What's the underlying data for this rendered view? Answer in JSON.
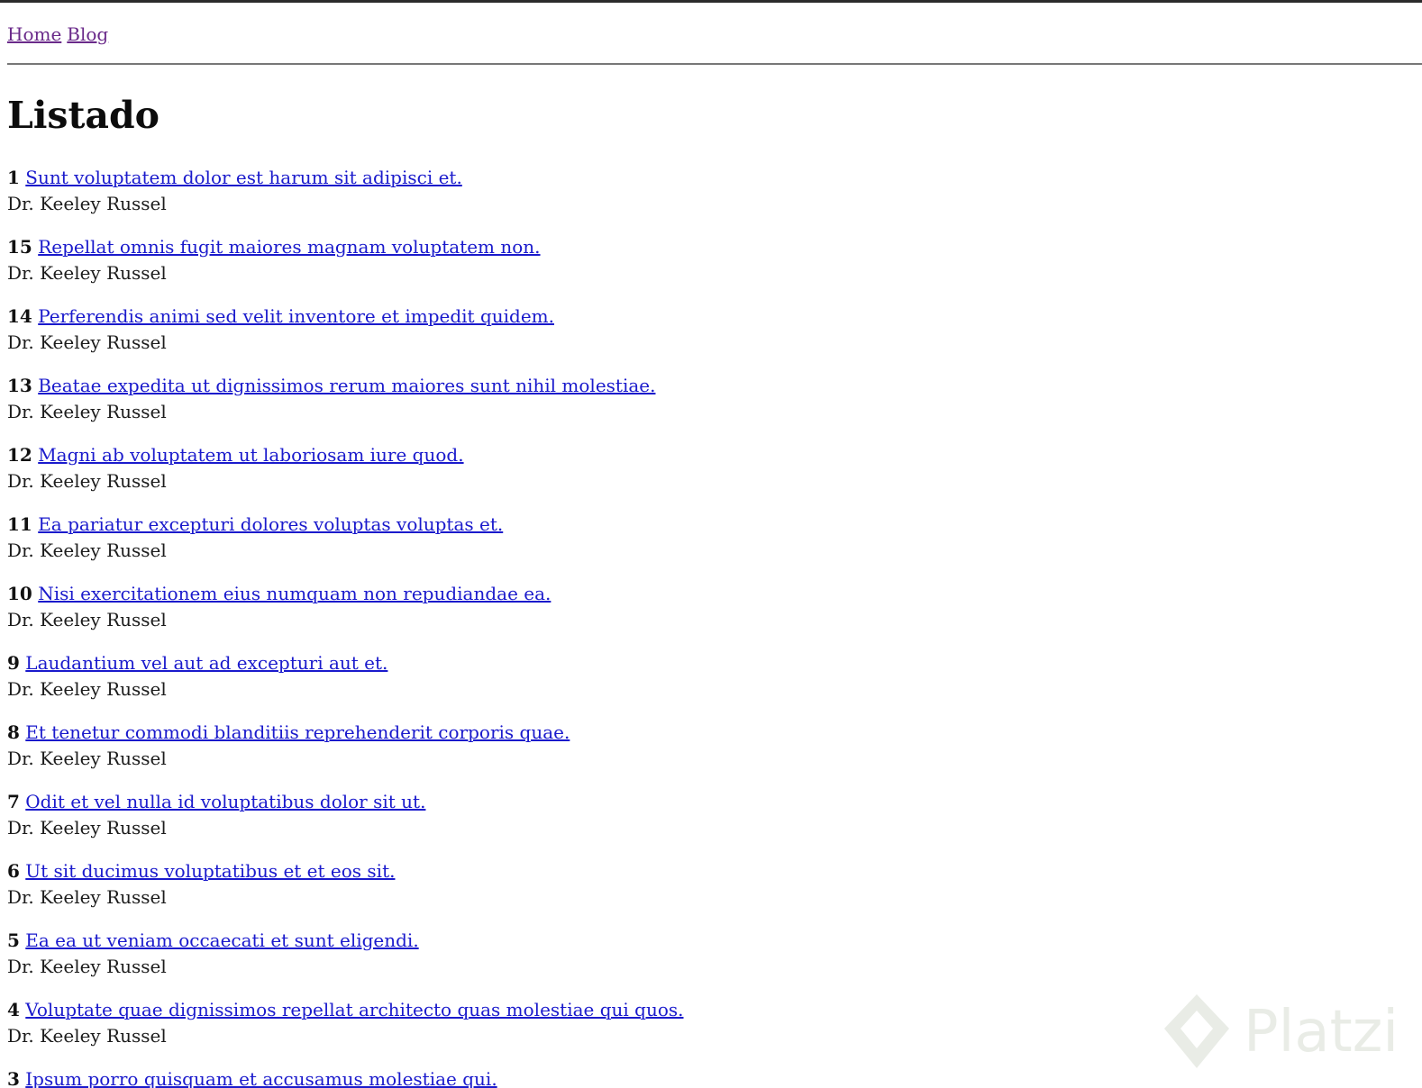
{
  "nav": {
    "links": [
      {
        "label": "Home"
      },
      {
        "label": "Blog"
      }
    ]
  },
  "page_title": "Listado",
  "posts": [
    {
      "id": "1",
      "title": "Sunt voluptatem dolor est harum sit adipisci et.",
      "author": "Dr. Keeley Russel"
    },
    {
      "id": "15",
      "title": "Repellat omnis fugit maiores magnam voluptatem non.",
      "author": "Dr. Keeley Russel"
    },
    {
      "id": "14",
      "title": "Perferendis animi sed velit inventore et impedit quidem.",
      "author": "Dr. Keeley Russel"
    },
    {
      "id": "13",
      "title": "Beatae expedita ut dignissimos rerum maiores sunt nihil molestiae.",
      "author": "Dr. Keeley Russel"
    },
    {
      "id": "12",
      "title": "Magni ab voluptatem ut laboriosam iure quod.",
      "author": "Dr. Keeley Russel"
    },
    {
      "id": "11",
      "title": "Ea pariatur excepturi dolores voluptas voluptas et.",
      "author": "Dr. Keeley Russel"
    },
    {
      "id": "10",
      "title": "Nisi exercitationem eius numquam non repudiandae ea.",
      "author": "Dr. Keeley Russel"
    },
    {
      "id": "9",
      "title": "Laudantium vel aut ad excepturi aut et.",
      "author": "Dr. Keeley Russel"
    },
    {
      "id": "8",
      "title": "Et tenetur commodi blanditiis reprehenderit corporis quae.",
      "author": "Dr. Keeley Russel"
    },
    {
      "id": "7",
      "title": "Odit et vel nulla id voluptatibus dolor sit ut.",
      "author": "Dr. Keeley Russel"
    },
    {
      "id": "6",
      "title": "Ut sit ducimus voluptatibus et et eos sit.",
      "author": "Dr. Keeley Russel"
    },
    {
      "id": "5",
      "title": "Ea ea ut veniam occaecati et sunt eligendi.",
      "author": "Dr. Keeley Russel"
    },
    {
      "id": "4",
      "title": "Voluptate quae dignissimos repellat architecto quas molestiae qui quos.",
      "author": "Dr. Keeley Russel"
    },
    {
      "id": "3",
      "title": "Ipsum porro quisquam et accusamus molestiae qui.",
      "author": ""
    }
  ],
  "watermark": {
    "text": "Platzi",
    "icon": "platzi-logo-icon"
  },
  "colors": {
    "link": "#1a1acc",
    "visited_link": "#6a2a8a",
    "text": "#111111",
    "rule": "#777777"
  }
}
